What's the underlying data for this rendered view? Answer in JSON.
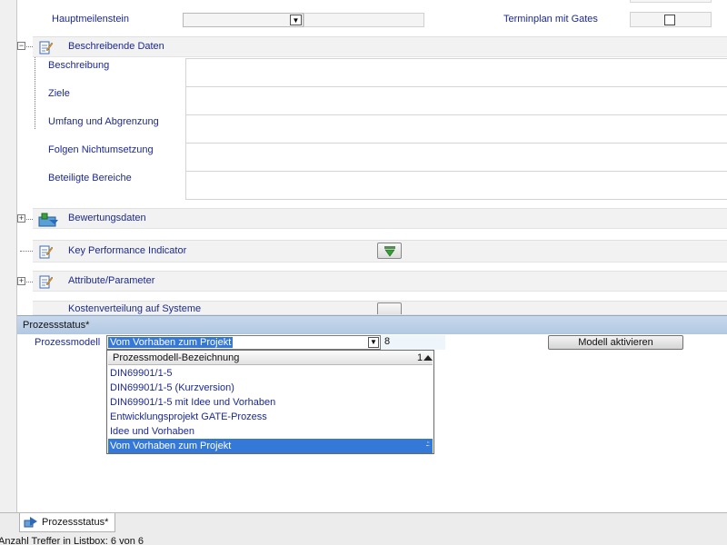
{
  "top_row": {
    "hauptmeilenstein_label": "Hauptmeilenstein",
    "terminplan_label": "Terminplan mit Gates"
  },
  "sections": {
    "beschreibende_daten": "Beschreibende Daten",
    "bewertungsdaten": "Bewertungsdaten",
    "kpi": "Key Performance Indicator",
    "attribute": "Attribute/Parameter",
    "kosten": "Kostenverteilung auf Systeme"
  },
  "description_fields": {
    "beschreibung": "Beschreibung",
    "ziele": "Ziele",
    "umfang": "Umfang und Abgrenzung",
    "folgen": "Folgen Nichtumsetzung",
    "bereiche": "Beteiligte Bereiche"
  },
  "prozessstatus": {
    "header": "Prozessstatus*",
    "prozessmodell_label": "Prozessmodell",
    "selected_value": "Vom Vorhaben zum Projekt",
    "count": "8",
    "activate_button": "Modell aktivieren"
  },
  "dropdown": {
    "column_header": "Prozessmodell-Bezeichnung",
    "sort_indicator": "1",
    "options": [
      "DIN69901/1-5",
      "DIN69901/1-5 (Kurzversion)",
      "DIN69901/1-5 mit Idee und Vorhaben",
      "Entwicklungsprojekt GATE-Prozess",
      "Idee und Vorhaben",
      "Vom Vorhaben zum Projekt"
    ],
    "selected_index": 5
  },
  "bottom_tab": {
    "label": "Prozessstatus*"
  },
  "status_bar": {
    "text": "Anzahl Treffer in Listbox: 6 von 6"
  },
  "colors": {
    "label_text": "#1c2a8c",
    "selection": "#3478d8",
    "panel_header": "#b8cce4"
  },
  "icons": {
    "section_doc": "pencil-document-icon",
    "bewertung": "chart-data-icon",
    "kpi_action": "green-arrow-down-icon",
    "tab": "process-icon"
  }
}
